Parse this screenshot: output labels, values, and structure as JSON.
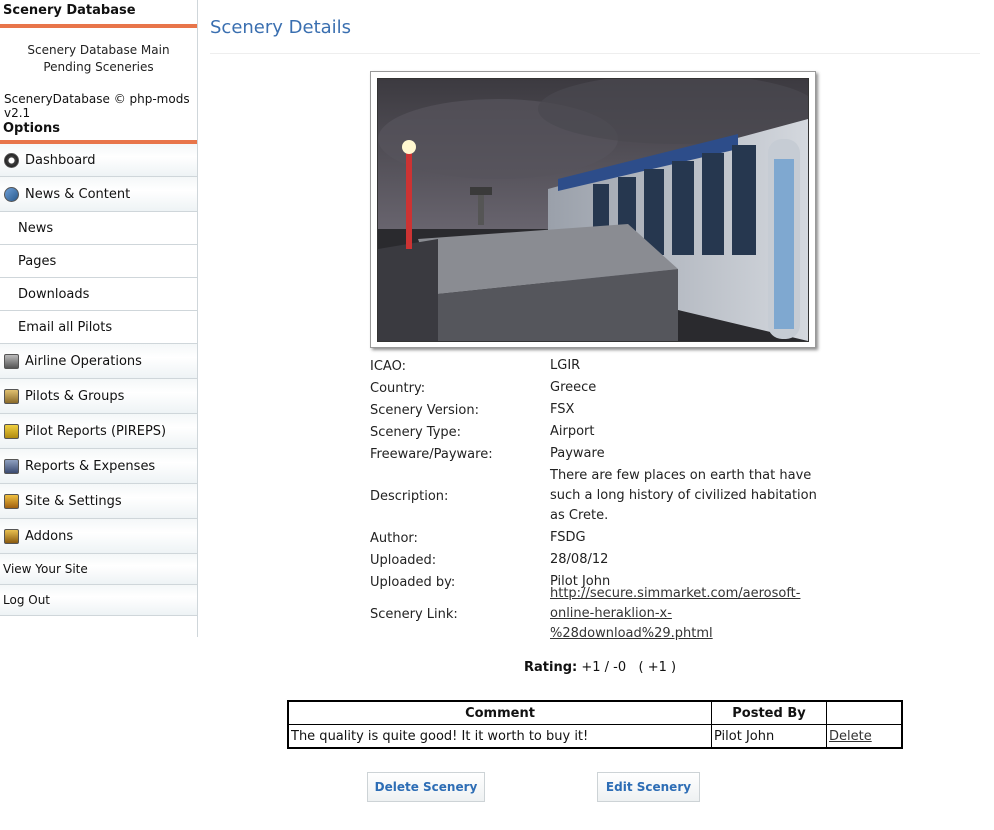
{
  "sidebar": {
    "header": "Scenery Database",
    "links": [
      "Scenery Database Main",
      "Pending Sceneries"
    ],
    "copyright_name": "SceneryDatabase © ",
    "copyright_vendor": "php-mods",
    "copyright_version": " v2.1",
    "options_header": "Options",
    "nav": [
      {
        "label": "Dashboard",
        "icon": "dashboard-icon"
      },
      {
        "label": "News & Content",
        "icon": "globe-icon"
      },
      {
        "label": "News"
      },
      {
        "label": "Pages"
      },
      {
        "label": "Downloads"
      },
      {
        "label": "Email all Pilots"
      },
      {
        "label": "Airline Operations",
        "icon": "airline-icon"
      },
      {
        "label": "Pilots & Groups",
        "icon": "pilots-icon"
      },
      {
        "label": "Pilot Reports (PIREPS)",
        "icon": "reports-icon"
      },
      {
        "label": "Reports & Expenses",
        "icon": "expenses-icon"
      },
      {
        "label": "Site & Settings",
        "icon": "settings-icon"
      },
      {
        "label": "Addons",
        "icon": "addons-icon"
      },
      {
        "label": "View Your Site"
      },
      {
        "label": "Log Out"
      }
    ]
  },
  "main": {
    "title": "Scenery Details",
    "details": [
      {
        "key": "ICAO:",
        "value": "LGIR"
      },
      {
        "key": "Country:",
        "value": "Greece"
      },
      {
        "key": "Scenery Version:",
        "value": "FSX"
      },
      {
        "key": "Scenery Type:",
        "value": "Airport"
      },
      {
        "key": "Freeware/Payware:",
        "value": "Payware"
      },
      {
        "key": "Description:",
        "value": "There are few places on earth that have such a long history of civilized habitation as Crete."
      },
      {
        "key": "Author:",
        "value": "FSDG"
      },
      {
        "key": "Uploaded:",
        "value": "28/08/12"
      },
      {
        "key": "Uploaded by:",
        "value": "Pilot John"
      },
      {
        "key": "Scenery Link:",
        "value": "http://secure.simmarket.com/aerosoft-online-heraklion-x-%28download%29.phtml"
      }
    ],
    "rating": {
      "label": "Rating:",
      "value": "+1 / -0   ( +1 )"
    },
    "comments": {
      "headers": [
        "Comment",
        "Posted By",
        ""
      ],
      "rows": [
        {
          "comment": "The quality is quite good! It it worth to buy it!",
          "posted_by": "Pilot John",
          "action": "Delete"
        }
      ]
    },
    "buttons": {
      "delete": "Delete Scenery",
      "edit": "Edit Scenery"
    }
  },
  "colors": {
    "accent": "#e8754a",
    "title": "#3a6fb0",
    "button_text": "#2d6db5"
  }
}
